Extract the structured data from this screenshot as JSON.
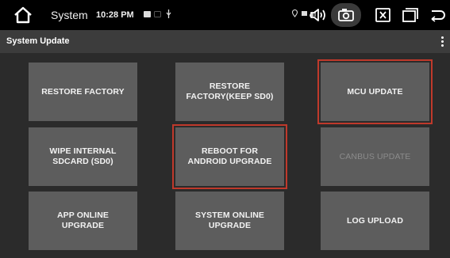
{
  "statusbar": {
    "title": "System",
    "time": "10:28 PM",
    "icons": [
      "home-icon",
      "notification-icon",
      "gallery-icon",
      "usb-icon",
      "location-icon",
      "signal-icon",
      "volume-icon",
      "camera-icon",
      "close-window-icon",
      "recent-apps-icon",
      "back-icon"
    ]
  },
  "appbar": {
    "title": "System Update"
  },
  "tiles": [
    {
      "label": "RESTORE FACTORY",
      "enabled": true,
      "focused": false
    },
    {
      "label": "RESTORE FACTORY(KEEP SD0)",
      "enabled": true,
      "focused": false
    },
    {
      "label": "MCU UPDATE",
      "enabled": true,
      "focused": true
    },
    {
      "label": "WIPE INTERNAL SDCARD (SD0)",
      "enabled": true,
      "focused": false
    },
    {
      "label": "REBOOT FOR ANDROID UPGRADE",
      "enabled": true,
      "focused": true
    },
    {
      "label": "CANBUS UPDATE",
      "enabled": false,
      "focused": false
    },
    {
      "label": "APP ONLINE UPGRADE",
      "enabled": true,
      "focused": false
    },
    {
      "label": "SYSTEM ONLINE UPGRADE",
      "enabled": true,
      "focused": false
    },
    {
      "label": "LOG UPLOAD",
      "enabled": true,
      "focused": false
    }
  ],
  "colors": {
    "accent_outline": "#c0392b",
    "tile": "#5d5d5d",
    "background": "#2b2b2b",
    "appbar": "#3c3c3c"
  }
}
